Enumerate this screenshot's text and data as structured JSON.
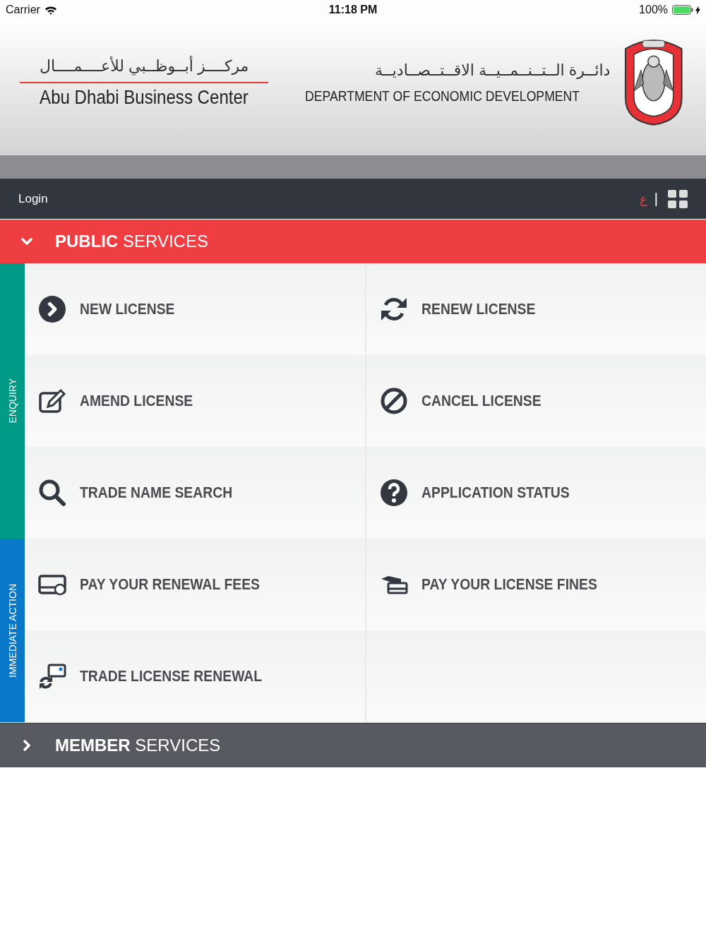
{
  "status_bar": {
    "carrier": "Carrier",
    "time": "11:18 PM",
    "battery": "100%"
  },
  "header": {
    "center_logo": {
      "arabic": "مركــــز أبــوظــبي للأعــــمــــال",
      "english": "Abu Dhabi Business Center"
    },
    "department_logo": {
      "arabic": "دائــرة الــتــنــمــيــة الاقــتــصــاديــة",
      "english": "DEPARTMENT OF ECONOMIC DEVELOPMENT"
    }
  },
  "nav_bar": {
    "login": "Login",
    "language": "ع",
    "separator": "|"
  },
  "sections": [
    {
      "title": "**PUBLIC** SERVICES",
      "expanded": true,
      "groups": [
        {
          "label": "ENQUIRY",
          "color": "#009b86",
          "services": [
            {
              "label": "NEW LICENSE",
              "kind": "chevron"
            },
            {
              "label": "RENEW LICENSE",
              "kind": "refresh"
            },
            {
              "label": "AMEND LICENSE",
              "kind": "edit"
            },
            {
              "label": "CANCEL LICENSE",
              "kind": "ban"
            },
            {
              "label": "TRADE NAME SEARCH",
              "kind": "search"
            },
            {
              "label": "APPLICATION STATUS",
              "kind": "question"
            }
          ]
        },
        {
          "label": "IMMEDIATE ACTION",
          "color": "#0a78c8",
          "services": [
            {
              "label": "PAY YOUR RENEWAL FEES",
              "kind": "card"
            },
            {
              "label": "PAY YOUR LICENSE FINES",
              "kind": "hand"
            },
            {
              "label": "TRADE LICENSE RENEWAL",
              "kind": "renewal"
            }
          ]
        }
      ]
    },
    {
      "title": "**MEMBER** SERVICES",
      "expanded": false
    }
  ]
}
